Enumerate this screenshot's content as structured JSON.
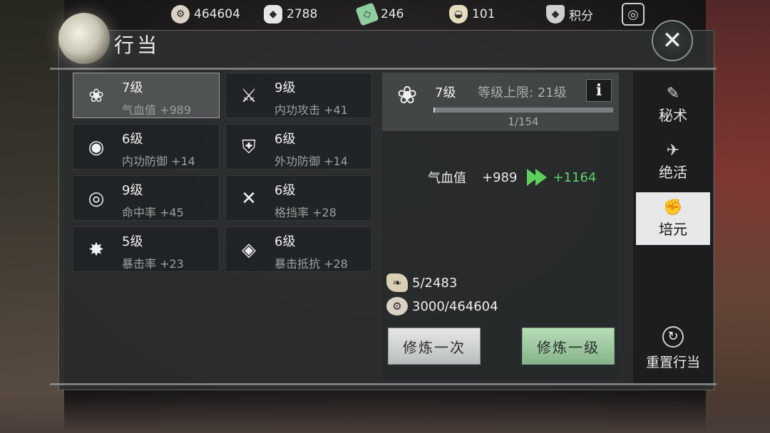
{
  "topbar": {
    "resources": [
      {
        "icon": "gear-coin-icon",
        "value": "464604"
      },
      {
        "icon": "silver-ingot-icon",
        "value": "2788"
      },
      {
        "icon": "jade-icon",
        "value": "246"
      },
      {
        "icon": "rice-bowl-icon",
        "value": "101"
      },
      {
        "icon": "shield-badge-icon",
        "value": "积分"
      }
    ]
  },
  "panel": {
    "title": "行当",
    "close_glyph": "✕"
  },
  "stats": [
    {
      "level": "7级",
      "desc": "气血值 +989",
      "icon": "lotus-heart-icon",
      "glyph": "❀",
      "selected": true
    },
    {
      "level": "9级",
      "desc": "内功攻击 +41",
      "icon": "sword-emblem-icon",
      "glyph": "⚔"
    },
    {
      "level": "6级",
      "desc": "内功防御 +14",
      "icon": "inner-shield-icon",
      "glyph": "◉"
    },
    {
      "level": "6级",
      "desc": "外功防御 +14",
      "icon": "outer-shield-icon",
      "glyph": "⛨"
    },
    {
      "level": "9级",
      "desc": "命中率 +45",
      "icon": "target-icon",
      "glyph": "◎"
    },
    {
      "level": "6级",
      "desc": "格挡率 +28",
      "icon": "crossed-swords-icon",
      "glyph": "✕"
    },
    {
      "level": "5级",
      "desc": "暴击率 +23",
      "icon": "burst-icon",
      "glyph": "✸"
    },
    {
      "level": "6级",
      "desc": "暴击抵抗 +28",
      "icon": "shield-strike-icon",
      "glyph": "◈"
    }
  ],
  "detail": {
    "icon": "lotus-heart-icon",
    "glyph": "❀",
    "level": "7级",
    "cap": "等级上限: 21级",
    "info": "i",
    "progress_text": "1/154",
    "progress_fraction": 0.0065,
    "gain_name": "气血值",
    "gain_current": "+989",
    "gain_next": "+1164",
    "cost_items": [
      {
        "icon": "leaf-material-icon",
        "text": "5/2483"
      },
      {
        "icon": "gear-coin-icon",
        "text": "3000/464604"
      }
    ],
    "btn_once": "修炼一次",
    "btn_level": "修炼一级"
  },
  "side_tabs": [
    {
      "label": "秘术",
      "icon": "scroll-icon",
      "glyph": "✎",
      "active": false
    },
    {
      "label": "绝活",
      "icon": "crossbow-icon",
      "glyph": "✈",
      "active": false
    },
    {
      "label": "培元",
      "icon": "strength-arm-icon",
      "glyph": "✊",
      "active": true
    }
  ],
  "reset": {
    "label": "重置行当",
    "glyph": "↻"
  },
  "colors": {
    "accent_green": "#5fd36a",
    "active_tab": "#e6e9e8"
  }
}
